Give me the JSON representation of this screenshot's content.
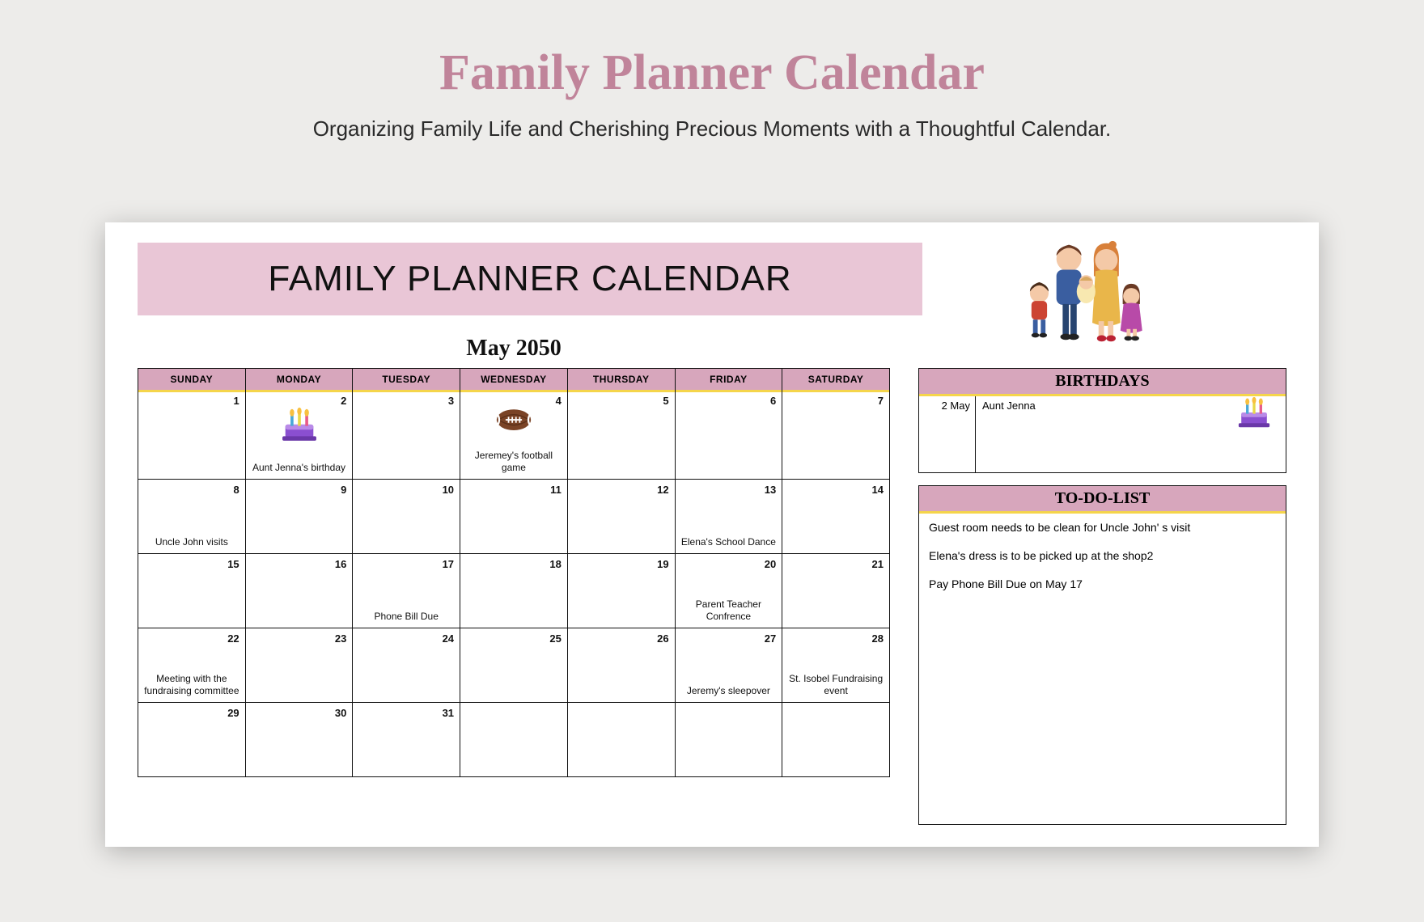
{
  "page": {
    "title": "Family Planner Calendar",
    "subtitle": "Organizing Family Life and Cherishing Precious Moments with a Thoughtful Calendar."
  },
  "banner": {
    "title": "FAMILY PLANNER CALENDAR"
  },
  "month": "May 2050",
  "weekdays": [
    "SUNDAY",
    "MONDAY",
    "TUESDAY",
    "WEDNESDAY",
    "THURSDAY",
    "FRIDAY",
    "SATURDAY"
  ],
  "weeks": [
    [
      {
        "num": "1"
      },
      {
        "num": "2",
        "event": "Aunt Jenna's birthday",
        "icon": "cake"
      },
      {
        "num": "3"
      },
      {
        "num": "4",
        "event": "Jeremey's football game",
        "icon": "football"
      },
      {
        "num": "5"
      },
      {
        "num": "6"
      },
      {
        "num": "7"
      }
    ],
    [
      {
        "num": "8",
        "event": "Uncle John visits"
      },
      {
        "num": "9"
      },
      {
        "num": "10"
      },
      {
        "num": "11"
      },
      {
        "num": "12"
      },
      {
        "num": "13",
        "event": "Elena's School Dance"
      },
      {
        "num": "14"
      }
    ],
    [
      {
        "num": "15"
      },
      {
        "num": "16"
      },
      {
        "num": "17",
        "event": "Phone Bill Due"
      },
      {
        "num": "18"
      },
      {
        "num": "19"
      },
      {
        "num": "20",
        "event": "Parent Teacher Confrence"
      },
      {
        "num": "21"
      }
    ],
    [
      {
        "num": "22",
        "event": "Meeting with the fundraising committee"
      },
      {
        "num": "23"
      },
      {
        "num": "24"
      },
      {
        "num": "25"
      },
      {
        "num": "26"
      },
      {
        "num": "27",
        "event": "Jeremy's sleepover"
      },
      {
        "num": "28",
        "event": "St. Isobel Fundraising event"
      }
    ],
    [
      {
        "num": "29"
      },
      {
        "num": "30"
      },
      {
        "num": "31"
      },
      {
        "num": ""
      },
      {
        "num": ""
      },
      {
        "num": ""
      },
      {
        "num": ""
      }
    ]
  ],
  "birthdays": {
    "header": "BIRTHDAYS",
    "date": "2 May",
    "name": "Aunt Jenna"
  },
  "todo": {
    "header": "TO-DO-LIST",
    "items": [
      "Guest room needs to be clean for Uncle John' s visit",
      "Elena's dress is to be picked up at the shop2",
      "Pay Phone Bill Due on May 17"
    ]
  }
}
